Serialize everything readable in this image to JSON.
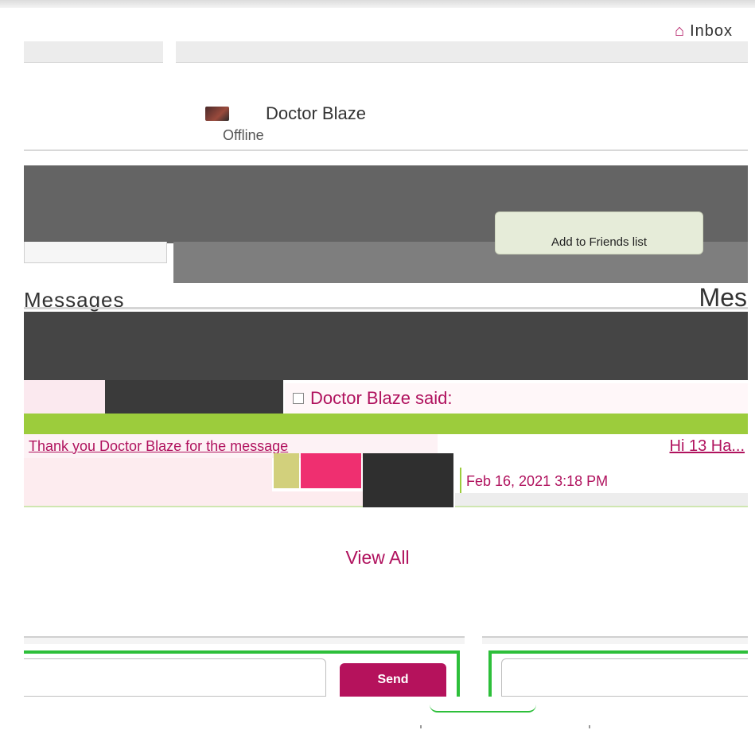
{
  "header": {
    "inbox_label": "Inbox",
    "inbox_icon": "home-icon"
  },
  "profile": {
    "name": "Doctor Blaze",
    "status": "Offline",
    "add_friend_label": "Add to Friends list"
  },
  "messages": {
    "heading_left": "Messages",
    "heading_right": "Mes",
    "thread": {
      "sender_line": "Doctor Blaze said:",
      "sent_message": "Thank you Doctor Blaze for the message",
      "preview_right": "Hi 13 Ha..."
    },
    "timestamp": "Feb 16, 2021 3:18 PM",
    "view_all_label": "View All"
  },
  "compose": {
    "placeholder": "",
    "send_label": "Send"
  },
  "colors": {
    "accent": "#b0125e",
    "send_button": "#b5125c",
    "highlight_green": "#2dbf3a",
    "bar_green": "#9ccc3c"
  }
}
